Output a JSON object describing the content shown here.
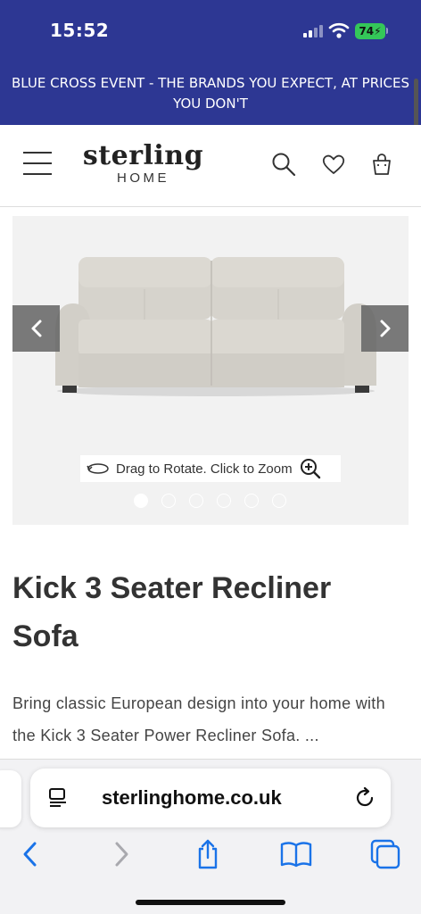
{
  "status_bar": {
    "time": "15:52",
    "battery": "74"
  },
  "promo_banner": {
    "text": "BLUE CROSS EVENT - THE BRANDS YOU EXPECT, AT PRICES YOU DON'T"
  },
  "header": {
    "logo_main": "sterling",
    "logo_sub": "HOME",
    "icons": [
      "menu-icon",
      "search-icon",
      "heart-icon",
      "bag-icon"
    ]
  },
  "gallery": {
    "hint": "Drag to Rotate. Click to Zoom",
    "slide_count": 6,
    "active_slide": 1,
    "icons": [
      "chevron-left-icon",
      "chevron-right-icon",
      "rotate-icon",
      "zoom-in-icon"
    ]
  },
  "product": {
    "title": "Kick 3 Seater Recliner Sofa",
    "description": "Bring classic European design into your home with the Kick 3 Seater Power Recliner Sofa. ..."
  },
  "browser": {
    "url": "sterlinghome.co.uk",
    "icons": [
      "reader-icon",
      "reload-icon",
      "back-icon",
      "forward-icon",
      "share-icon",
      "bookmarks-icon",
      "tabs-icon"
    ]
  },
  "colors": {
    "brand_blue": "#2d3793",
    "ios_blue": "#1a73e8",
    "battery_green": "#34c759"
  }
}
